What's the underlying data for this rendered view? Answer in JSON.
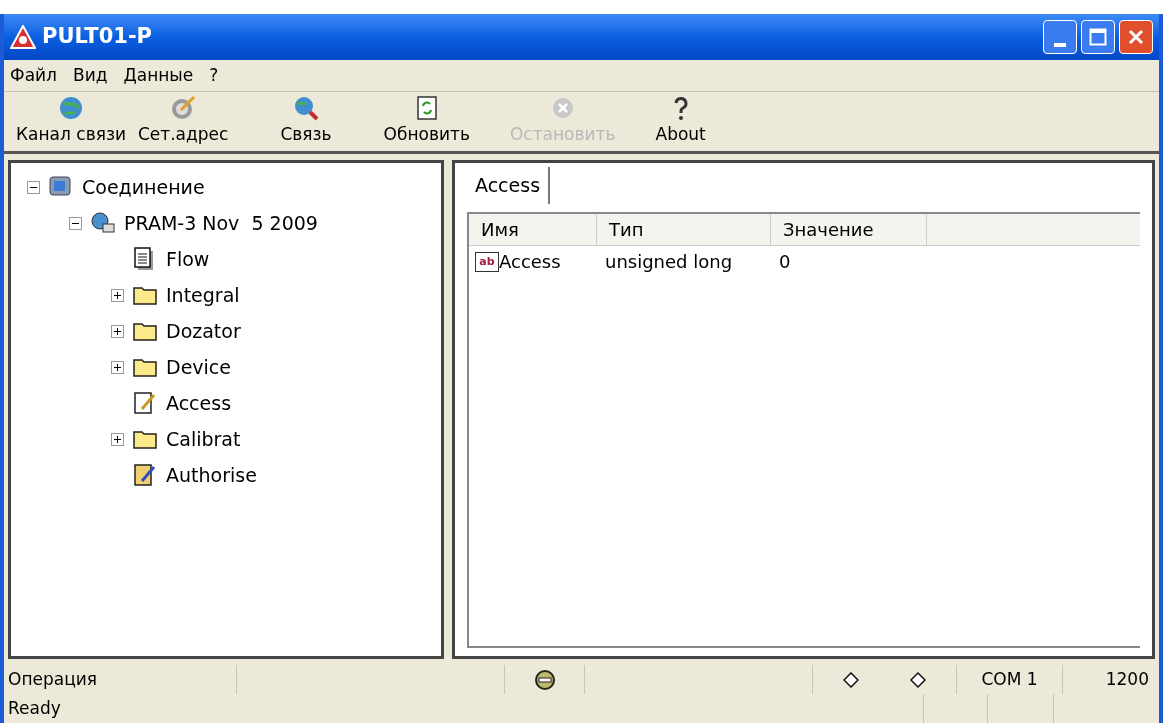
{
  "window": {
    "title": "PULT01-P"
  },
  "menu": [
    "Файл",
    "Вид",
    "Данные",
    "?"
  ],
  "toolbar": [
    {
      "label": "Канал связи",
      "kind": "globe",
      "disabled": false
    },
    {
      "label": "Сет.адрес",
      "kind": "dial",
      "disabled": false
    },
    {
      "label": "Связь",
      "kind": "search",
      "disabled": false
    },
    {
      "label": "Обновить",
      "kind": "refresh",
      "disabled": false
    },
    {
      "label": "Остановить",
      "kind": "stop",
      "disabled": true
    },
    {
      "label": "About",
      "kind": "help",
      "disabled": false
    }
  ],
  "tree": [
    {
      "label": "Соединение",
      "kind": "connection",
      "expanded": true,
      "children": [
        {
          "label": "PRAM-3 Nov  5 2009",
          "kind": "device",
          "expanded": true,
          "children": [
            {
              "label": "Flow",
              "kind": "document"
            },
            {
              "label": "Integral",
              "kind": "folder",
              "expanded": false
            },
            {
              "label": "Dozator",
              "kind": "folder",
              "expanded": false
            },
            {
              "label": "Device",
              "kind": "folder",
              "expanded": false
            },
            {
              "label": "Access",
              "kind": "edit"
            },
            {
              "label": "Calibrat",
              "kind": "folder",
              "expanded": false
            },
            {
              "label": "Authorise",
              "kind": "key"
            }
          ]
        }
      ]
    }
  ],
  "tabs": [
    {
      "label": "Access",
      "selected": true
    }
  ],
  "table": {
    "columns": [
      "Имя",
      "Тип",
      "Значение"
    ],
    "rows": [
      {
        "icon_text": "ab",
        "name": "Access",
        "type": "unsigned long",
        "value": "0"
      }
    ]
  },
  "status_bar": {
    "operation": "Операция",
    "com": "COM 1",
    "baud": "1200",
    "message": "Ready"
  }
}
